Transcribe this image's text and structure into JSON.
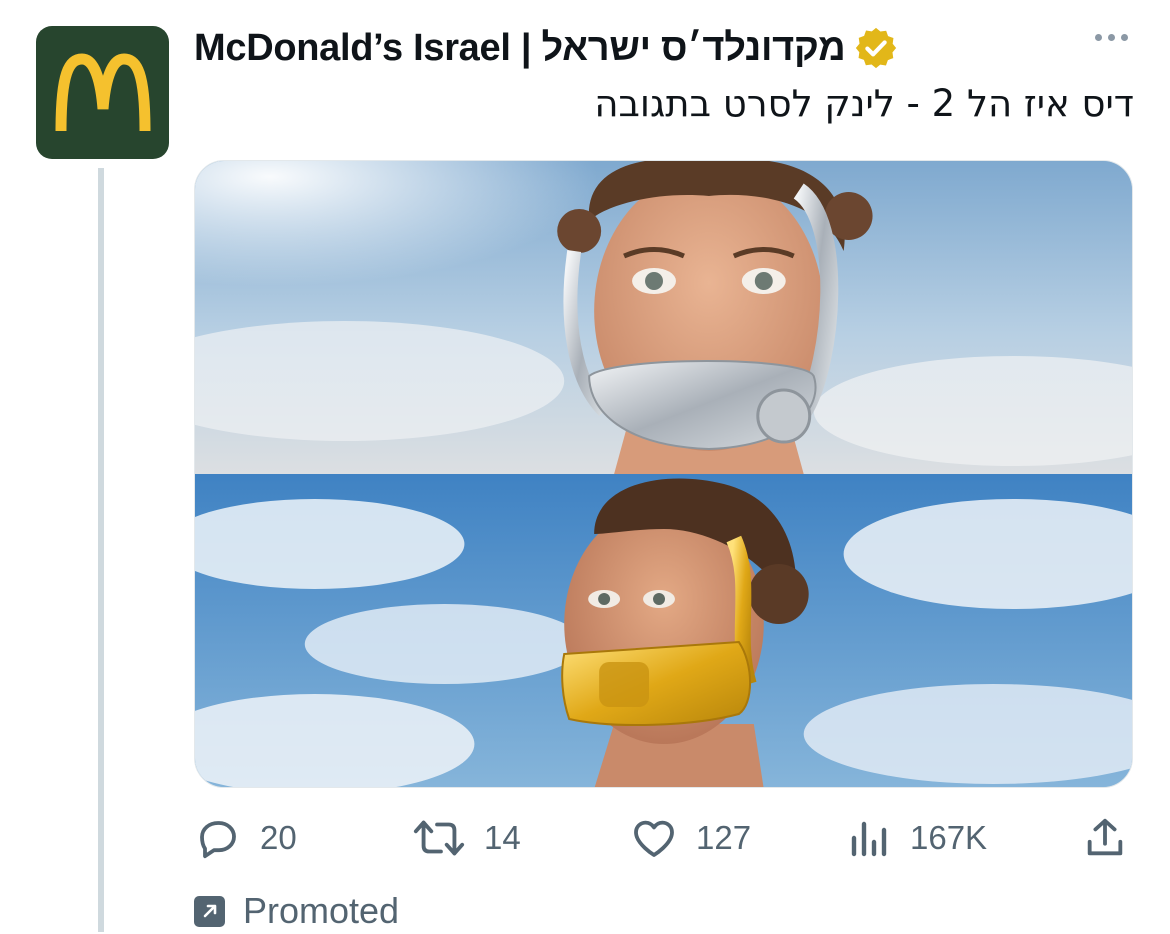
{
  "tweet": {
    "display_name": "McDonald’s Israel | מקדונלד׳ס ישראל",
    "verified_icon": "verified-badge-icon",
    "text": "דיס איז הל 2 - לינק לסרט בתגובה",
    "media_alt": "Two frames: a man wearing a silver mouth mask, and a man wearing a gold mouth mask, against a sky with clouds"
  },
  "avatar": {
    "icon": "mcdonalds-golden-arches-logo",
    "bg": "#27452e",
    "arches": "#f5c12e"
  },
  "actions": {
    "reply": {
      "icon": "reply-icon",
      "count": "20"
    },
    "retweet": {
      "icon": "retweet-icon",
      "count": "14"
    },
    "like": {
      "icon": "heart-icon",
      "count": "127"
    },
    "views": {
      "icon": "views-bar-chart-icon",
      "count": "167K"
    },
    "share": {
      "icon": "share-icon"
    }
  },
  "promoted": {
    "label": "Promoted",
    "icon": "promoted-arrow-icon"
  },
  "colors": {
    "muted": "#536471",
    "thread_line": "#cfd9de",
    "verified_gold": "#e2b719"
  }
}
